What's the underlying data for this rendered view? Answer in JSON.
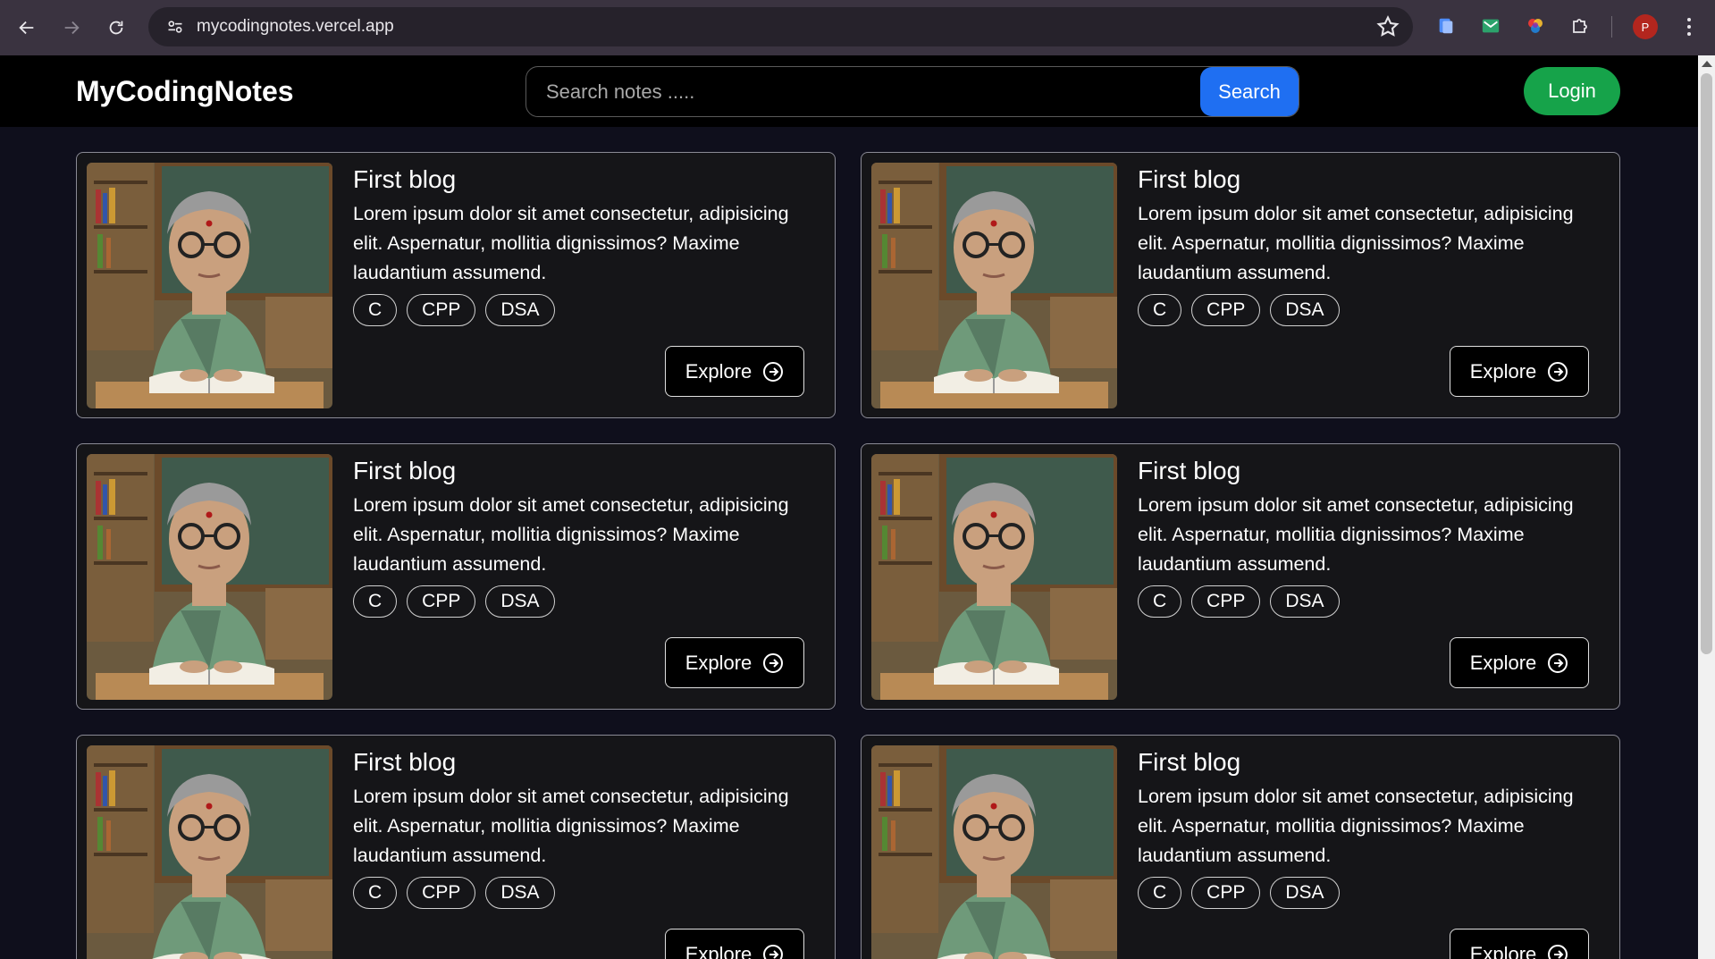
{
  "browser": {
    "url": "mycodingnotes.vercel.app",
    "profile_initial": "P"
  },
  "site": {
    "brand": "MyCodingNotes",
    "search_placeholder": "Search notes .....",
    "search_button": "Search",
    "login_button": "Login"
  },
  "cards": [
    {
      "title": "First blog",
      "description": "Lorem ipsum dolor sit amet consectetur, adipisicing elit. Aspernatur, mollitia dignissimos? Maxime laudantium assumend.",
      "tags": [
        "C",
        "CPP",
        "DSA"
      ],
      "button": "Explore"
    },
    {
      "title": "First blog",
      "description": "Lorem ipsum dolor sit amet consectetur, adipisicing elit. Aspernatur, mollitia dignissimos? Maxime laudantium assumend.",
      "tags": [
        "C",
        "CPP",
        "DSA"
      ],
      "button": "Explore"
    },
    {
      "title": "First blog",
      "description": "Lorem ipsum dolor sit amet consectetur, adipisicing elit. Aspernatur, mollitia dignissimos? Maxime laudantium assumend.",
      "tags": [
        "C",
        "CPP",
        "DSA"
      ],
      "button": "Explore"
    },
    {
      "title": "First blog",
      "description": "Lorem ipsum dolor sit amet consectetur, adipisicing elit. Aspernatur, mollitia dignissimos? Maxime laudantium assumend.",
      "tags": [
        "C",
        "CPP",
        "DSA"
      ],
      "button": "Explore"
    },
    {
      "title": "First blog",
      "description": "Lorem ipsum dolor sit amet consectetur, adipisicing elit. Aspernatur, mollitia dignissimos? Maxime laudantium assumend.",
      "tags": [
        "C",
        "CPP",
        "DSA"
      ],
      "button": "Explore"
    },
    {
      "title": "First blog",
      "description": "Lorem ipsum dolor sit amet consectetur, adipisicing elit. Aspernatur, mollitia dignissimos? Maxime laudantium assumend.",
      "tags": [
        "C",
        "CPP",
        "DSA"
      ],
      "button": "Explore"
    }
  ],
  "colors": {
    "accent_search": "#1f6ff2",
    "accent_login": "#16a34a",
    "page_bg": "#0f0f1c",
    "card_bg": "#151518"
  },
  "icons": {
    "back": "arrow-left-icon",
    "forward": "arrow-right-icon",
    "reload": "reload-icon",
    "site_info": "tune-icon",
    "bookmark": "star-icon",
    "explore": "arrow-circle-right-icon"
  }
}
